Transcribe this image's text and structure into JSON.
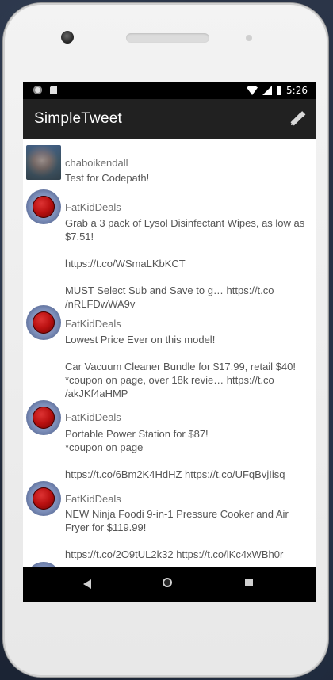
{
  "app": {
    "title": "SimpleTweet"
  },
  "status_bar": {
    "time": "5:26"
  },
  "icons": {
    "compose": "compose-pencil-icon",
    "back": "nav-back-icon",
    "home": "nav-home-icon",
    "recents": "nav-recents-icon",
    "wifi": "wifi-icon",
    "signal": "signal-icon",
    "battery": "battery-icon"
  },
  "feed": {
    "tweets": [
      {
        "username": "chaboikendall",
        "text": "Test for Codepath!"
      },
      {
        "username": "FatKidDeals",
        "text": "Grab a 3 pack of Lysol Disinfectant Wipes, as low as $7.51!\n\nhttps://t.co/WSmaLKbKCT\n\nMUST Select Sub and Save to g… https://t.co /nRLFDwWA9v"
      },
      {
        "username": "FatKidDeals",
        "text": "Lowest Price Ever on this model!\n\nCar Vacuum Cleaner Bundle for $17.99, retail $40!\n*coupon on page, over 18k revie… https://t.co /akJKf4aHMP"
      },
      {
        "username": "FatKidDeals",
        "text": "Portable Power Station for $87!\n*coupon on page\n\nhttps://t.co/6Bm2K4HdHZ https://t.co/UFqBvjIisq"
      },
      {
        "username": "FatKidDeals",
        "text": "NEW Ninja Foodi 9-in-1 Pressure Cooker and Air Fryer for $119.99!\n\nhttps://t.co/2O9tUL2k32 https://t.co/lKc4xWBh0r"
      }
    ]
  }
}
